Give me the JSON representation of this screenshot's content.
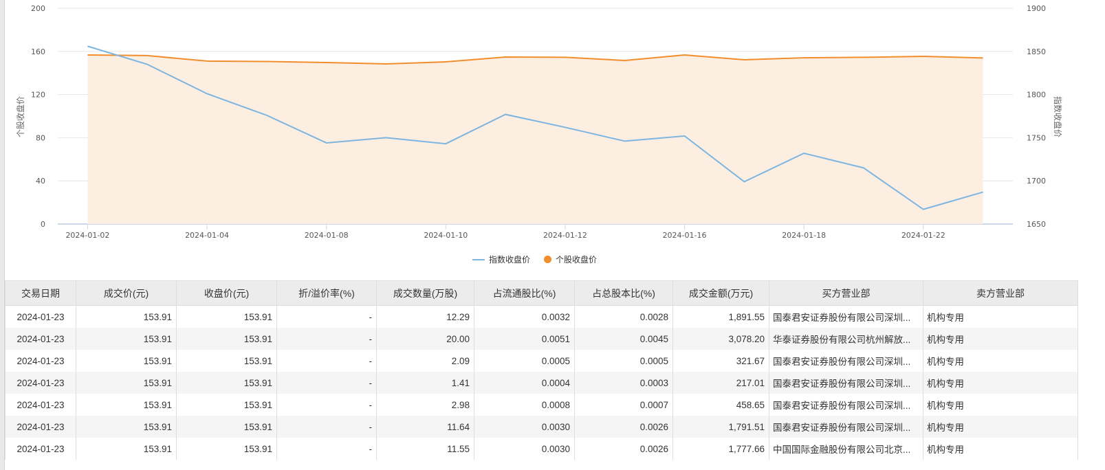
{
  "chart_data": {
    "type": "line",
    "x": [
      "2024-01-02",
      "2024-01-03",
      "2024-01-04",
      "2024-01-05",
      "2024-01-08",
      "2024-01-09",
      "2024-01-10",
      "2024-01-11",
      "2024-01-12",
      "2024-01-15",
      "2024-01-16",
      "2024-01-17",
      "2024-01-18",
      "2024-01-19",
      "2024-01-22",
      "2024-01-23"
    ],
    "x_tick_labels": [
      "2024-01-02",
      "2024-01-04",
      "2024-01-08",
      "2024-01-10",
      "2024-01-12",
      "2024-01-16",
      "2024-01-18",
      "2024-01-22"
    ],
    "series": [
      {
        "name": "指数收盘价",
        "axis": "right",
        "color": "#7cb5e0",
        "values": [
          1856,
          1835,
          1801,
          1776,
          1744,
          1750,
          1743,
          1777,
          1762,
          1746,
          1752,
          1699,
          1732,
          1715,
          1667,
          1687
        ]
      },
      {
        "name": "个股收盘价",
        "axis": "left",
        "color": "#f28d2c",
        "area": true,
        "values": [
          156.7,
          156.1,
          151.0,
          150.6,
          149.7,
          148.4,
          150.3,
          154.8,
          154.5,
          151.6,
          156.7,
          152.2,
          154.1,
          154.5,
          155.4,
          153.91
        ]
      }
    ],
    "left_axis": {
      "label": "个股收盘价",
      "ylim": [
        0,
        200
      ],
      "ticks": [
        "0",
        "40",
        "80",
        "120",
        "160",
        "200"
      ]
    },
    "right_axis": {
      "label": "指数收盘价",
      "ylim": [
        1650,
        1900
      ],
      "ticks": [
        "1650",
        "1700",
        "1750",
        "1800",
        "1850",
        "1900"
      ]
    },
    "grid": true,
    "legend": "bottom-center"
  },
  "table": {
    "headers": [
      "交易日期",
      "成交价(元)",
      "收盘价(元)",
      "折/溢价率(%)",
      "成交数量(万股)",
      "占流通股比(%)",
      "占总股本比(%)",
      "成交金额(万元)",
      "买方营业部",
      "卖方营业部"
    ],
    "rows": [
      [
        "2024-01-23",
        "153.91",
        "153.91",
        "-",
        "12.29",
        "0.0032",
        "0.0028",
        "1,891.55",
        "国泰君安证券股份有限公司深圳...",
        "机构专用"
      ],
      [
        "2024-01-23",
        "153.91",
        "153.91",
        "-",
        "20.00",
        "0.0051",
        "0.0045",
        "3,078.20",
        "华泰证券股份有限公司杭州解放...",
        "机构专用"
      ],
      [
        "2024-01-23",
        "153.91",
        "153.91",
        "-",
        "2.09",
        "0.0005",
        "0.0005",
        "321.67",
        "国泰君安证券股份有限公司深圳...",
        "机构专用"
      ],
      [
        "2024-01-23",
        "153.91",
        "153.91",
        "-",
        "1.41",
        "0.0004",
        "0.0003",
        "217.01",
        "国泰君安证券股份有限公司深圳...",
        "机构专用"
      ],
      [
        "2024-01-23",
        "153.91",
        "153.91",
        "-",
        "2.98",
        "0.0008",
        "0.0007",
        "458.65",
        "国泰君安证券股份有限公司深圳...",
        "机构专用"
      ],
      [
        "2024-01-23",
        "153.91",
        "153.91",
        "-",
        "11.64",
        "0.0030",
        "0.0026",
        "1,791.51",
        "国泰君安证券股份有限公司深圳...",
        "机构专用"
      ],
      [
        "2024-01-23",
        "153.91",
        "153.91",
        "-",
        "11.55",
        "0.0030",
        "0.0026",
        "1,777.66",
        "中国国际金融股份有限公司北京...",
        "机构专用"
      ]
    ]
  }
}
